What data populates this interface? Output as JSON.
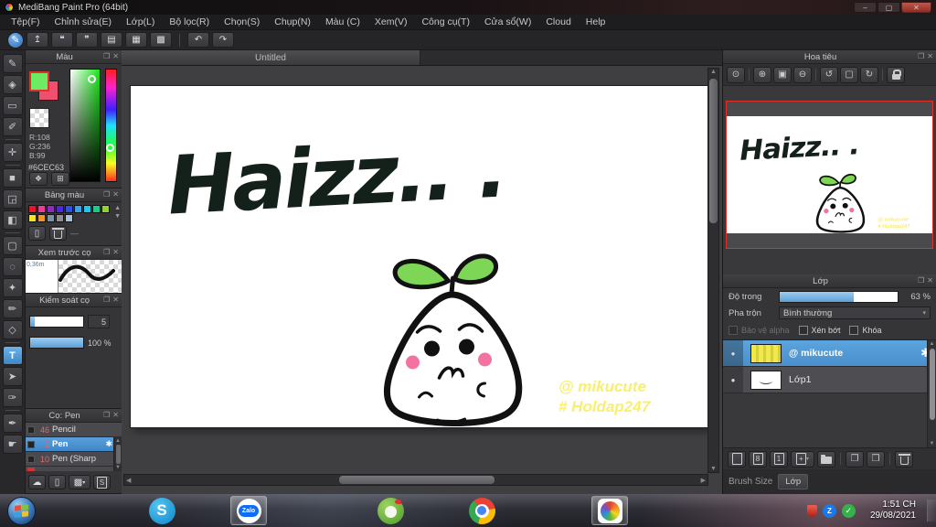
{
  "window": {
    "title": "MediBang Paint Pro (64bit)",
    "min": "–",
    "max": "▢",
    "close": "✕"
  },
  "ui": {
    "popout": "❐",
    "close": "✕",
    "up": "▲",
    "down": "▼",
    "left": "◀",
    "right": "▶",
    "caret": "▾"
  },
  "menu": {
    "items": [
      "Tệp(F)",
      "Chỉnh sửa(E)",
      "Lớp(L)",
      "Bộ lọc(R)",
      "Chọn(S)",
      "Chụp(N)",
      "Màu (C)",
      "Xem(V)",
      "Công cụ(T)",
      "Cửa sổ(W)",
      "Cloud",
      "Help"
    ]
  },
  "toolbar": {
    "items": [
      {
        "name": "medibang-brush-icon",
        "glyph": "✎"
      },
      {
        "name": "export-icon",
        "glyph": "↥"
      },
      {
        "name": "comment-icon",
        "glyph": "❝"
      },
      {
        "name": "chat-icon",
        "glyph": "❞"
      },
      {
        "name": "document-icon",
        "glyph": "▤"
      },
      {
        "name": "document-settings-icon",
        "glyph": "▦"
      },
      {
        "name": "canvas-settings-icon",
        "glyph": "▩"
      },
      {
        "name": "undo-icon",
        "glyph": "↶"
      },
      {
        "name": "redo-icon",
        "glyph": "↷"
      }
    ]
  },
  "tools": {
    "items": [
      {
        "name": "brush-tool",
        "glyph": "✎"
      },
      {
        "name": "eraser-tool",
        "glyph": "◈"
      },
      {
        "name": "figure-tool",
        "glyph": "▭"
      },
      {
        "name": "snap-tool",
        "glyph": "✐"
      },
      {
        "name": "move-tool",
        "glyph": "✛"
      },
      {
        "name": "fill-tool",
        "glyph": "■"
      },
      {
        "name": "bucket-tool",
        "glyph": "◲"
      },
      {
        "name": "gradient-tool",
        "glyph": "◧"
      },
      {
        "name": "select-tool",
        "glyph": "▢"
      },
      {
        "name": "lasso-tool",
        "glyph": "◌"
      },
      {
        "name": "magicwand-tool",
        "glyph": "✦"
      },
      {
        "name": "select-pen-tool",
        "glyph": "✏"
      },
      {
        "name": "select-eraser-tool",
        "glyph": "◇"
      },
      {
        "name": "text-tool",
        "glyph": "T"
      },
      {
        "name": "operate-tool",
        "glyph": "➤"
      },
      {
        "name": "divide-tool",
        "glyph": "✑"
      },
      {
        "name": "eyedropper-tool",
        "glyph": "✒"
      },
      {
        "name": "hand-tool",
        "glyph": "☛"
      }
    ]
  },
  "color_panel": {
    "title": "Màu",
    "r": "R:108",
    "g": "G:236",
    "b": "B:99",
    "hex": "#6CEC63",
    "foreground": "#6cec63",
    "background_color": "#f0506e",
    "buttons": [
      {
        "name": "palette-dialog-icon",
        "glyph": "❖"
      },
      {
        "name": "color-picker-icon",
        "glyph": "⊞"
      }
    ]
  },
  "palette_panel": {
    "title": "Bảng màu",
    "row1": [
      "#e5182b",
      "#ea3d96",
      "#8f2bbf",
      "#4b2bd9",
      "#2b55e0",
      "#3f9fe8",
      "#1fc7ea",
      "#1fc98c",
      "#97cc3d"
    ],
    "row2": [
      "#f2e426",
      "#f29426",
      "#7b93a9",
      "#8e8e8e",
      "#a9c1d2"
    ],
    "add_glyph": "▯",
    "divider": "—"
  },
  "preview_panel": {
    "title": "Xem trước cọ",
    "size_label": "0,36m"
  },
  "control_panel": {
    "title": "Kiểm soát cọ",
    "size_value": "5",
    "opacity_value": "100 %",
    "size_fill_pct": 8,
    "opacity_fill_pct": 100
  },
  "brush_panel": {
    "title": "Cọ: Pen",
    "gear": "✱",
    "brushes": [
      {
        "size": "46",
        "name": "Pencil",
        "selected": false
      },
      {
        "size": "5",
        "name": "Pen",
        "selected": true
      },
      {
        "size": "10",
        "name": "Pen (Sharp",
        "selected": false
      }
    ],
    "buttons": [
      {
        "name": "cloud-brush-icon",
        "glyph": "☁"
      },
      {
        "name": "new-brush-icon",
        "glyph": "▯"
      },
      {
        "name": "image-brush-icon",
        "glyph": "▩"
      },
      {
        "name": "script-brush-icon",
        "glyph": "S"
      }
    ]
  },
  "canvas": {
    "tab": "Untitled",
    "art": {
      "text": "Haizz.. .",
      "wm1": "@ mikucute",
      "wm2": "# Holdap247",
      "ink": "#14211a",
      "watermark_color": "#f9ef6f",
      "leaf_green": "#7dd656",
      "cheek_pink": "#f272a2"
    }
  },
  "navigator": {
    "title": "Hoa tiêu",
    "tools": [
      {
        "name": "zoom-100-icon",
        "glyph": "⊙"
      },
      {
        "name": "zoom-in-icon",
        "glyph": "⊕"
      },
      {
        "name": "fit-window-icon",
        "glyph": "▣"
      },
      {
        "name": "zoom-out-icon",
        "glyph": "⊖"
      },
      {
        "name": "rotate-left-icon",
        "glyph": "↺"
      },
      {
        "name": "reset-view-icon",
        "glyph": "▢"
      },
      {
        "name": "rotate-right-icon",
        "glyph": "↻"
      }
    ]
  },
  "layer_panel": {
    "title": "Lớp",
    "opacity_label": "Độ trong",
    "opacity_value": "63 %",
    "opacity_pct": 63,
    "blend_label": "Pha trộn",
    "blend_value": "Bình thường",
    "checkbox1": "Bảo vệ alpha",
    "checkbox2": "Xén bớt",
    "checkbox3": "Khóa",
    "eye_glyph": "●",
    "gear": "✱",
    "layers": [
      {
        "name": "@ mikucute",
        "selected": true
      },
      {
        "name": "Lớp1",
        "selected": false
      }
    ],
    "buttons": [
      {
        "name": "new-layer-icon",
        "glyph": ""
      },
      {
        "name": "layer-8bit-icon",
        "glyph": "8"
      },
      {
        "name": "layer-1bit-icon",
        "glyph": "1"
      },
      {
        "name": "add-layer-icon",
        "glyph": "+"
      },
      {
        "name": "duplicate-layer-icon",
        "glyph": "❐"
      },
      {
        "name": "combine-layer-icon",
        "glyph": "❒"
      }
    ],
    "selected_color": "#4a90cc"
  },
  "statusbar": {
    "brush_size": "Brush Size",
    "layer_tab": "Lớp"
  },
  "taskbar": {
    "time": "1:51 CH",
    "date": "29/08/2021",
    "skype_letter": "S",
    "zalo_label": "Zalo",
    "tray_zalo": "Z",
    "check_glyph": "✓",
    "apps": [
      "start",
      "skype",
      "zalo",
      "coccoc",
      "chrome",
      "medibang"
    ],
    "tray": [
      "antivirus-shield",
      "zalo-tray",
      "green-check"
    ]
  }
}
